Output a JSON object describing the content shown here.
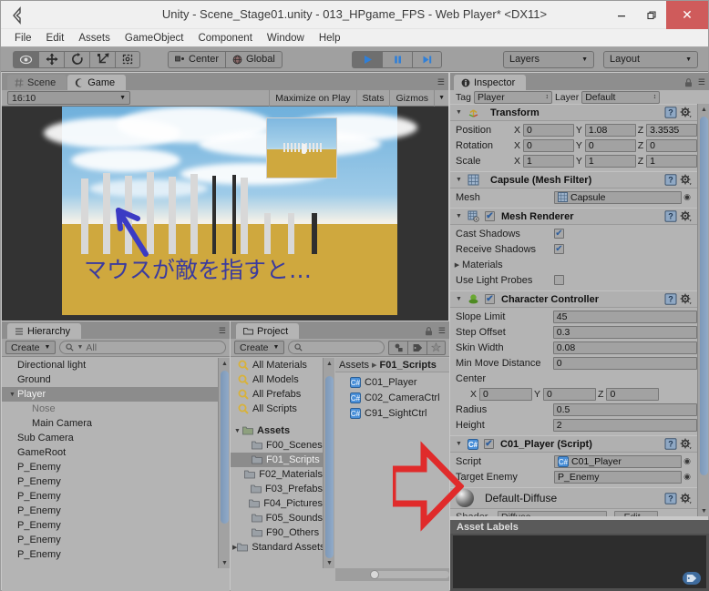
{
  "window": {
    "title": "Unity - Scene_Stage01.unity - 013_HPgame_FPS - Web Player* <DX11>",
    "minimize": "–",
    "restore": "❐",
    "close": "✕"
  },
  "menubar": {
    "items": [
      "File",
      "Edit",
      "Assets",
      "GameObject",
      "Component",
      "Window",
      "Help"
    ]
  },
  "toolbar": {
    "tools": [
      {
        "name": "hand-tool",
        "glyph": "◉",
        "active": true
      },
      {
        "name": "move-tool",
        "glyph": "✥",
        "active": false
      },
      {
        "name": "rotate-tool",
        "glyph": "↻",
        "active": false
      },
      {
        "name": "scale-tool",
        "glyph": "⤡",
        "active": false
      },
      {
        "name": "rect-tool",
        "glyph": "□",
        "active": false
      }
    ],
    "pivot_label": "Center",
    "space_label": "Global",
    "play_label": "▶",
    "pause_label": "❙❙",
    "step_label": "▶❘",
    "layers_label": "Layers",
    "layout_label": "Layout",
    "dropdown_arrow": "▼"
  },
  "gameview": {
    "tabs": [
      {
        "label": "Scene",
        "icon": "grid-icon",
        "active": false
      },
      {
        "label": "Game",
        "icon": "gamepad-icon",
        "active": true
      }
    ],
    "aspect": "16:10",
    "maximize_label": "Maximize on Play",
    "stats_label": "Stats",
    "gizmos_label": "Gizmos",
    "overlay_text": "マウスが敵を指すと…",
    "overlay_color": "#3b3b9e",
    "ground_color": "#cfa83e",
    "sky_color": "#6fb0dc"
  },
  "hierarchy": {
    "tab_label": "Hierarchy",
    "create_label": "Create",
    "search_placeholder": "All",
    "items": [
      {
        "label": "Directional light",
        "indent": 0,
        "selected": false,
        "expandable": false,
        "dim": false
      },
      {
        "label": "Ground",
        "indent": 0,
        "selected": false,
        "expandable": false,
        "dim": false
      },
      {
        "label": "Player",
        "indent": 0,
        "selected": true,
        "expandable": true,
        "dim": false
      },
      {
        "label": "Nose",
        "indent": 1,
        "selected": false,
        "expandable": false,
        "dim": true
      },
      {
        "label": "Main Camera",
        "indent": 1,
        "selected": false,
        "expandable": false,
        "dim": false
      },
      {
        "label": "Sub Camera",
        "indent": 0,
        "selected": false,
        "expandable": false,
        "dim": false
      },
      {
        "label": "GameRoot",
        "indent": 0,
        "selected": false,
        "expandable": false,
        "dim": false
      },
      {
        "label": "P_Enemy",
        "indent": 0,
        "selected": false,
        "expandable": false,
        "dim": false
      },
      {
        "label": "P_Enemy",
        "indent": 0,
        "selected": false,
        "expandable": false,
        "dim": false
      },
      {
        "label": "P_Enemy",
        "indent": 0,
        "selected": false,
        "expandable": false,
        "dim": false
      },
      {
        "label": "P_Enemy",
        "indent": 0,
        "selected": false,
        "expandable": false,
        "dim": false
      },
      {
        "label": "P_Enemy",
        "indent": 0,
        "selected": false,
        "expandable": false,
        "dim": false
      },
      {
        "label": "P_Enemy",
        "indent": 0,
        "selected": false,
        "expandable": false,
        "dim": false
      },
      {
        "label": "P_Enemy",
        "indent": 0,
        "selected": false,
        "expandable": false,
        "dim": false
      }
    ]
  },
  "project": {
    "tab_label": "Project",
    "create_label": "Create",
    "search_placeholder": "",
    "filters": [
      {
        "label": "All Materials",
        "icon": "search-icon"
      },
      {
        "label": "All Models",
        "icon": "search-icon"
      },
      {
        "label": "All Prefabs",
        "icon": "search-icon"
      },
      {
        "label": "All Scripts",
        "icon": "search-icon"
      }
    ],
    "tree": [
      {
        "label": "Assets",
        "indent": 0,
        "expandable": true,
        "expanded": true,
        "selected": false,
        "bold": true
      },
      {
        "label": "F00_Scenes",
        "indent": 1,
        "expandable": false,
        "expanded": false,
        "selected": false,
        "bold": false
      },
      {
        "label": "F01_Scripts",
        "indent": 1,
        "expandable": false,
        "expanded": false,
        "selected": true,
        "bold": false
      },
      {
        "label": "F02_Materials",
        "indent": 1,
        "expandable": false,
        "expanded": false,
        "selected": false,
        "bold": false
      },
      {
        "label": "F03_Prefabs",
        "indent": 1,
        "expandable": false,
        "expanded": false,
        "selected": false,
        "bold": false
      },
      {
        "label": "F04_Pictures",
        "indent": 1,
        "expandable": false,
        "expanded": false,
        "selected": false,
        "bold": false
      },
      {
        "label": "F05_Sounds",
        "indent": 1,
        "expandable": false,
        "expanded": false,
        "selected": false,
        "bold": false
      },
      {
        "label": "F90_Others",
        "indent": 1,
        "expandable": false,
        "expanded": false,
        "selected": false,
        "bold": false
      },
      {
        "label": "Standard Assets",
        "indent": 0,
        "expandable": true,
        "expanded": false,
        "selected": false,
        "bold": false
      }
    ],
    "breadcrumb": [
      {
        "label": "Assets",
        "bold": false
      },
      {
        "label": "F01_Scripts",
        "bold": true
      }
    ],
    "breadcrumb_sep": "▸",
    "files": [
      {
        "label": "C01_Player",
        "icon": "csharp-script-icon"
      },
      {
        "label": "C02_CameraCtrl",
        "icon": "csharp-script-icon"
      },
      {
        "label": "C91_SightCtrl",
        "icon": "csharp-script-icon"
      }
    ]
  },
  "inspector": {
    "tab_label": "Inspector",
    "tag_label": "Tag",
    "tag_value": "Player",
    "layer_label": "Layer",
    "layer_value": "Default",
    "components": [
      {
        "name": "Transform",
        "icon": "transform-icon",
        "has_checkbox": false,
        "checked": false,
        "expanded": true,
        "rows": [
          {
            "type": "vector3",
            "label": "Position",
            "x": "0",
            "y": "1.08",
            "z": "3.3535"
          },
          {
            "type": "vector3",
            "label": "Rotation",
            "x": "0",
            "y": "0",
            "z": "0"
          },
          {
            "type": "vector3",
            "label": "Scale",
            "x": "1",
            "y": "1",
            "z": "1"
          }
        ]
      },
      {
        "name": "Capsule (Mesh Filter)",
        "icon": "mesh-filter-icon",
        "has_checkbox": false,
        "checked": false,
        "expanded": true,
        "rows": [
          {
            "type": "object",
            "label": "Mesh",
            "value": "Capsule",
            "icon": "mesh-icon"
          }
        ]
      },
      {
        "name": "Mesh Renderer",
        "icon": "mesh-renderer-icon",
        "has_checkbox": true,
        "checked": true,
        "expanded": true,
        "rows": [
          {
            "type": "checkbox",
            "label": "Cast Shadows",
            "checked": true
          },
          {
            "type": "checkbox",
            "label": "Receive Shadows",
            "checked": true
          },
          {
            "type": "foldout",
            "label": "Materials",
            "expanded": false
          },
          {
            "type": "checkbox",
            "label": "Use Light Probes",
            "checked": false
          }
        ]
      },
      {
        "name": "Character Controller",
        "icon": "character-controller-icon",
        "has_checkbox": true,
        "checked": true,
        "expanded": true,
        "rows": [
          {
            "type": "text",
            "label": "Slope Limit",
            "value": "45"
          },
          {
            "type": "text",
            "label": "Step Offset",
            "value": "0.3"
          },
          {
            "type": "text",
            "label": "Skin Width",
            "value": "0.08"
          },
          {
            "type": "text",
            "label": "Min Move Distance",
            "value": "0"
          },
          {
            "type": "label",
            "label": "Center"
          },
          {
            "type": "vector3-indent",
            "label": "",
            "x": "0",
            "y": "0",
            "z": "0"
          },
          {
            "type": "text",
            "label": "Radius",
            "value": "0.5"
          },
          {
            "type": "text",
            "label": "Height",
            "value": "2"
          }
        ]
      },
      {
        "name": "C01_Player (Script)",
        "icon": "csharp-script-icon",
        "has_checkbox": true,
        "checked": true,
        "expanded": true,
        "rows": [
          {
            "type": "object",
            "label": "Script",
            "value": "C01_Player",
            "icon": "csharp-script-icon"
          },
          {
            "type": "object",
            "label": "Target Enemy",
            "value": "P_Enemy",
            "icon": ""
          }
        ]
      }
    ],
    "material_preview": {
      "name": "Default-Diffuse",
      "shader_label": "Shader",
      "shader_value": "Diffuse",
      "edit_label": "Edit..."
    },
    "help_icon": "help-icon",
    "gear_icon": "gear-icon",
    "lock_icon": "lock-icon",
    "menu_icon": "menu-icon"
  },
  "asset_labels": {
    "title": "Asset Labels",
    "tag_icon": "label-tag-icon"
  },
  "annotation": {
    "arrow_color": "#e02b2b",
    "arrow_name": "red-pointer-arrow"
  }
}
